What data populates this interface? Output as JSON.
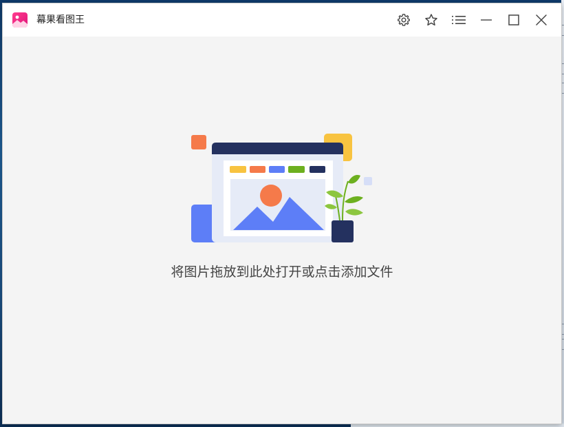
{
  "window": {
    "title": "幕果看图王"
  },
  "titlebar_buttons": {
    "settings": "gear-icon",
    "favorite": "star-icon",
    "menu": "list-menu-icon",
    "minimize": "minimize-icon",
    "maximize": "maximize-icon",
    "close": "close-icon"
  },
  "main": {
    "hint": "将图片拖放到此处打开或点击添加文件"
  },
  "colors": {
    "titlebar": "#ffffff",
    "content_bg": "#f4f4f4",
    "navy": "#24315f",
    "blue": "#5d7ef7",
    "orange": "#f57a4a",
    "yellow": "#f8c340",
    "green": "#6db01f"
  }
}
